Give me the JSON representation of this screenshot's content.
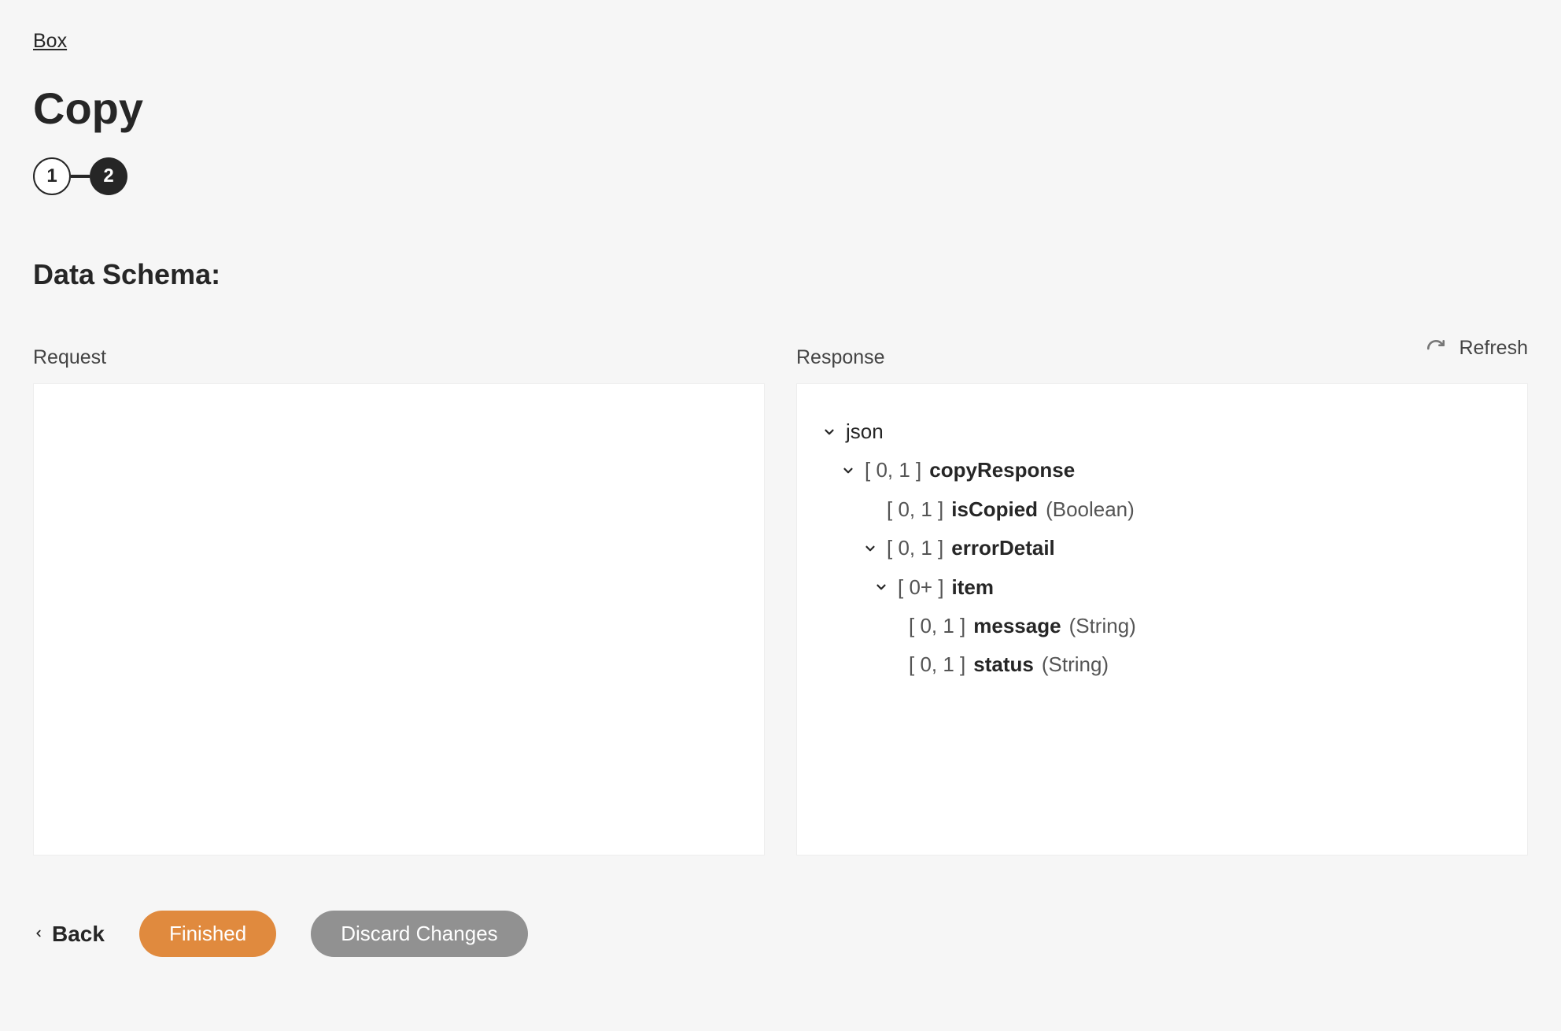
{
  "breadcrumb": {
    "root": "Box"
  },
  "page_title": "Copy",
  "stepper": {
    "step1": "1",
    "step2": "2"
  },
  "section_title": "Data Schema:",
  "panels": {
    "request_label": "Request",
    "response_label": "Response",
    "refresh_label": "Refresh"
  },
  "response_tree": {
    "json": "json",
    "copyResponse": {
      "card": "[ 0, 1 ]",
      "name": "copyResponse"
    },
    "isCopied": {
      "card": "[ 0, 1 ]",
      "name": "isCopied",
      "type": "(Boolean)"
    },
    "errorDetail": {
      "card": "[ 0, 1 ]",
      "name": "errorDetail"
    },
    "item": {
      "card": "[ 0+ ]",
      "name": "item"
    },
    "message": {
      "card": "[ 0, 1 ]",
      "name": "message",
      "type": "(String)"
    },
    "status": {
      "card": "[ 0, 1 ]",
      "name": "status",
      "type": "(String)"
    }
  },
  "footer": {
    "back": "Back",
    "finished": "Finished",
    "discard": "Discard Changes"
  }
}
